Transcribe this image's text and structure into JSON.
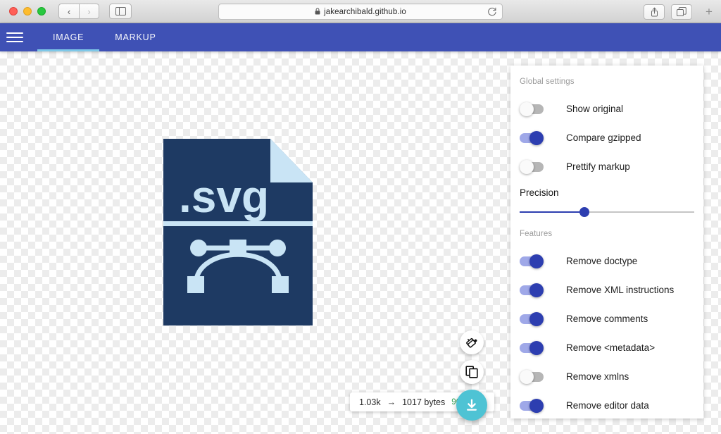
{
  "browser": {
    "traffic_lights": [
      "close",
      "minimize",
      "maximize"
    ],
    "back_label": "‹",
    "forward_label": "›",
    "sidebar_icon": "sidebar-icon",
    "url": "jakearchibald.github.io",
    "lock_icon": "lock-icon",
    "reload_icon": "reload-icon",
    "share_icon": "share-icon",
    "tabs_overview_icon": "tabs-overview-icon",
    "new_tab_label": "+"
  },
  "app_header": {
    "menu_icon": "hamburger-menu-icon",
    "accent_color": "#3f51b5",
    "active_indicator_color": "#7ec8e8",
    "tabs": [
      {
        "label": "IMAGE",
        "active": true
      },
      {
        "label": "MARKUP",
        "active": false
      }
    ]
  },
  "canvas": {
    "artwork": {
      "name": "svg-file-illustration",
      "extension_text": ".svg",
      "navy": "#1e3a63",
      "light_blue": "#bfdff2"
    },
    "fabs": [
      {
        "name": "background-toggle-fab",
        "icon": "paint-bucket-icon"
      },
      {
        "name": "copy-fab",
        "icon": "copy-icon"
      },
      {
        "name": "download-fab",
        "icon": "download-icon",
        "color": "#4ec3d4"
      }
    ],
    "size_chip": {
      "original_size": "1.03k",
      "arrow": "→",
      "new_size": "1017 bytes",
      "percent": "96.31%",
      "percent_color": "#2f9e4f"
    }
  },
  "settings_panel": {
    "groups": [
      {
        "title": "Global settings",
        "options": [
          {
            "label": "Show original",
            "on": false
          },
          {
            "label": "Compare gzipped",
            "on": true
          },
          {
            "label": "Prettify markup",
            "on": false
          }
        ],
        "slider": {
          "label": "Precision",
          "value_percent": 37,
          "track_color": "#c6c6c6",
          "fill_color": "#2d3eb0"
        }
      },
      {
        "title": "Features",
        "options": [
          {
            "label": "Remove doctype",
            "on": true
          },
          {
            "label": "Remove XML instructions",
            "on": true
          },
          {
            "label": "Remove comments",
            "on": true
          },
          {
            "label": "Remove <metadata>",
            "on": true
          },
          {
            "label": "Remove xmlns",
            "on": false
          },
          {
            "label": "Remove editor data",
            "on": true
          }
        ]
      }
    ]
  }
}
